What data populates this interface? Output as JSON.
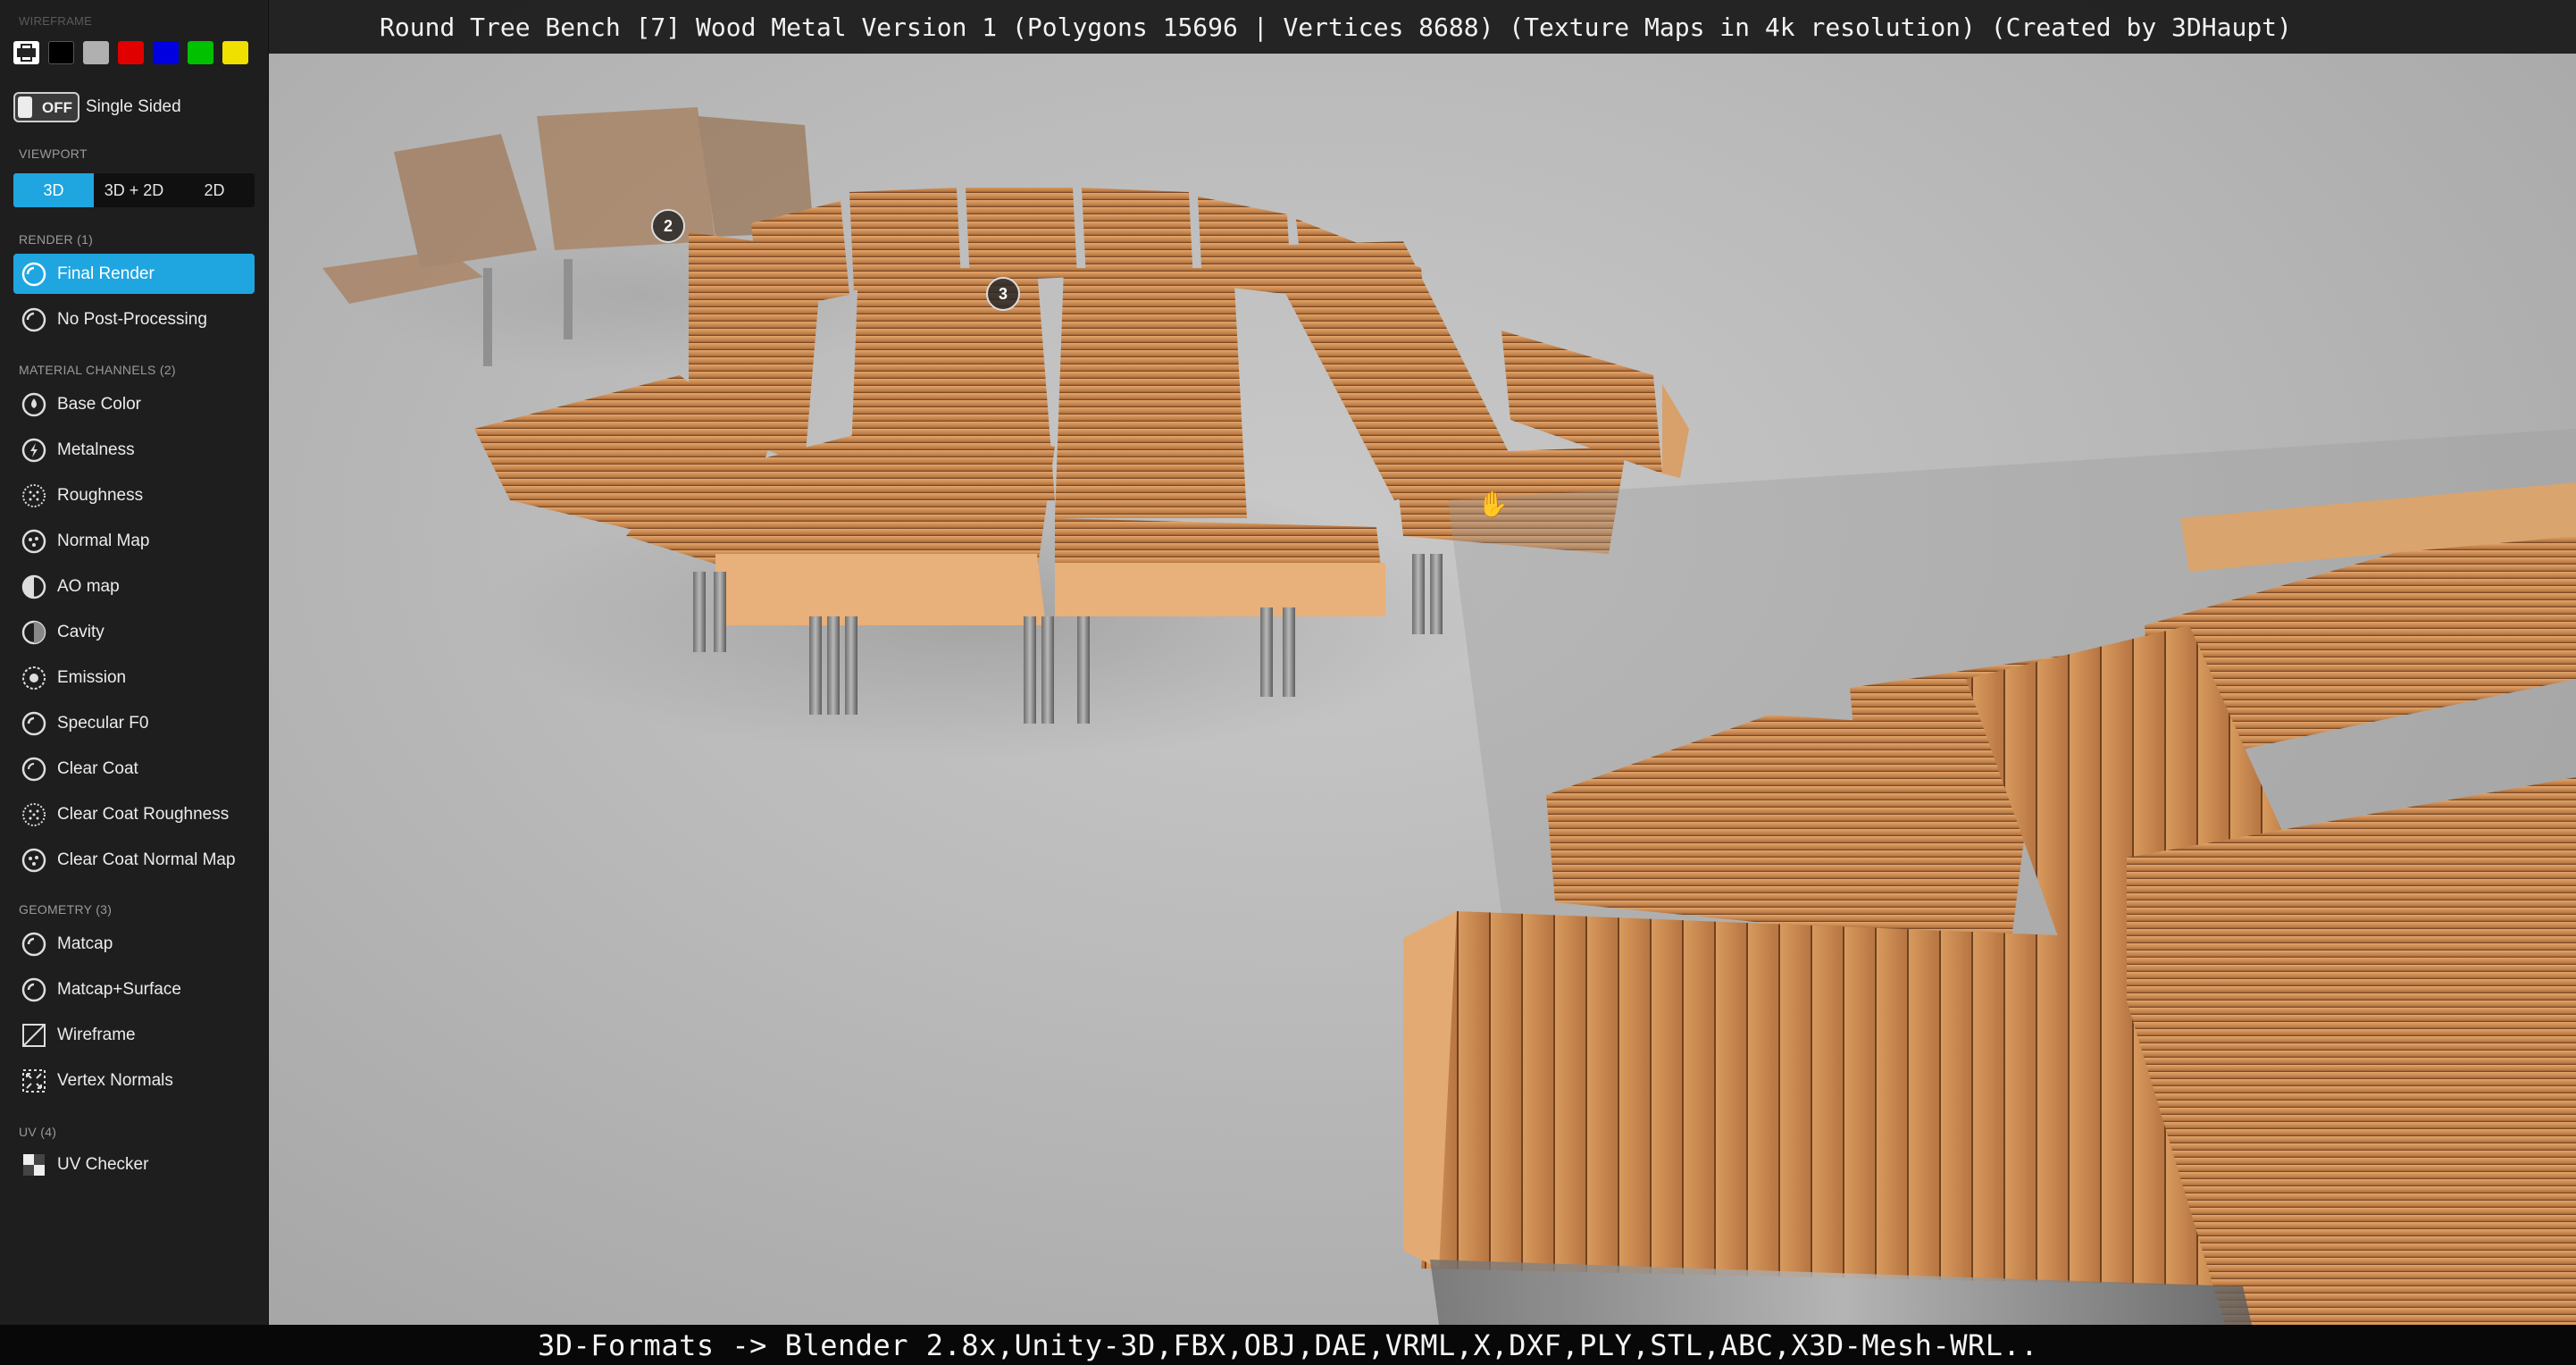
{
  "title": "Round Tree Bench [7] Wood Metal Version 1 (Polygons 15696 | Vertices 8688) (Texture Maps in 4k resolution) (Created by 3DHaupt)",
  "footer": "3D-Formats -> Blender 2.8x,Unity-3D,FBX,OBJ,DAE,VRML,X,DXF,PLY,STL,ABC,X3D-Mesh-WRL..",
  "sidebar": {
    "wireframe_label": "WIREFRAME",
    "wireframe_colors": [
      "#ffffff",
      "#000000",
      "#b0b0b0",
      "#e00000",
      "#0000e0",
      "#00c000",
      "#f0e000"
    ],
    "single_sided": {
      "state": "OFF",
      "label": "Single Sided"
    },
    "viewport": {
      "label": "VIEWPORT",
      "options": [
        "3D",
        "3D + 2D",
        "2D"
      ],
      "active": "3D"
    },
    "render": {
      "label": "RENDER (1)",
      "items": [
        {
          "label": "Final Render",
          "icon": "render-icon",
          "active": true
        },
        {
          "label": "No Post-Processing",
          "icon": "render-icon",
          "active": false
        }
      ]
    },
    "material": {
      "label": "MATERIAL CHANNELS (2)",
      "items": [
        {
          "label": "Base Color",
          "icon": "base-color-icon"
        },
        {
          "label": "Metalness",
          "icon": "metalness-icon"
        },
        {
          "label": "Roughness",
          "icon": "roughness-icon"
        },
        {
          "label": "Normal Map",
          "icon": "normal-map-icon"
        },
        {
          "label": "AO map",
          "icon": "ao-map-icon"
        },
        {
          "label": "Cavity",
          "icon": "cavity-icon"
        },
        {
          "label": "Emission",
          "icon": "emission-icon"
        },
        {
          "label": "Specular F0",
          "icon": "specular-icon"
        },
        {
          "label": "Clear Coat",
          "icon": "clear-coat-icon"
        },
        {
          "label": "Clear Coat Roughness",
          "icon": "roughness-icon"
        },
        {
          "label": "Clear Coat Normal Map",
          "icon": "normal-map-icon"
        }
      ]
    },
    "geometry": {
      "label": "GEOMETRY (3)",
      "items": [
        {
          "label": "Matcap",
          "icon": "matcap-icon"
        },
        {
          "label": "Matcap+Surface",
          "icon": "matcap-icon"
        },
        {
          "label": "Wireframe",
          "icon": "wireframe-icon"
        },
        {
          "label": "Vertex Normals",
          "icon": "vertex-normals-icon"
        }
      ]
    },
    "uv": {
      "label": "UV (4)",
      "items": [
        {
          "label": "UV Checker",
          "icon": "uv-checker-icon"
        }
      ]
    }
  },
  "annotations": [
    "2",
    "3"
  ],
  "colors": {
    "accent": "#1fa6e0",
    "sidebar_bg": "#1e1e1e",
    "wood": "#c8874f",
    "metal": "#8a8a8a"
  }
}
